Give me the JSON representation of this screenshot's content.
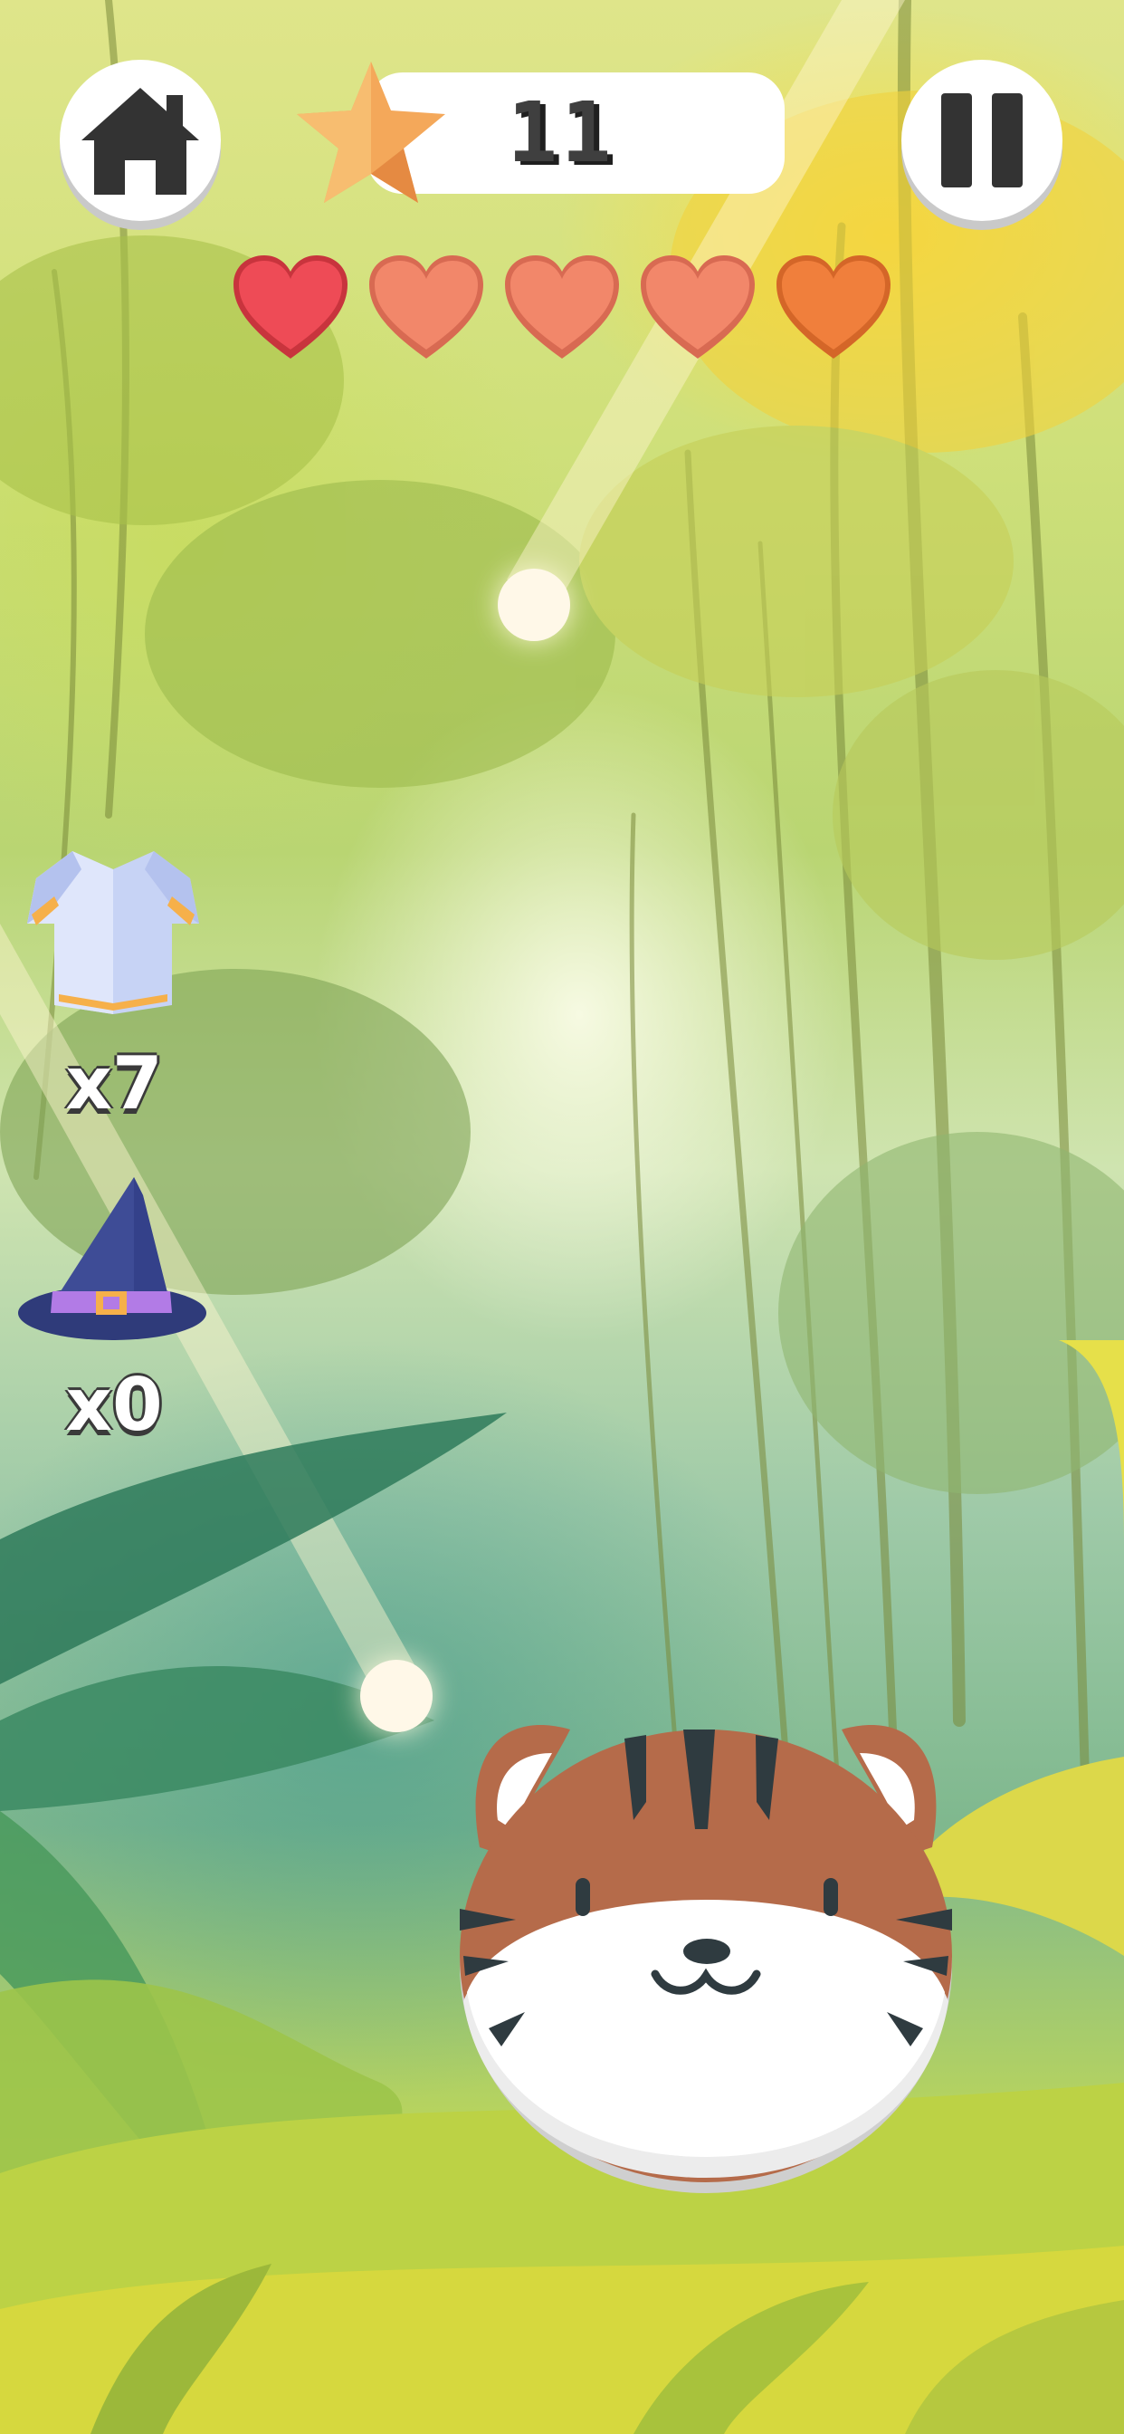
{
  "hud": {
    "score": "11",
    "icons": {
      "home": "home-icon",
      "star": "star-icon",
      "pause": "pause-icon",
      "heart": "heart-icon"
    },
    "hearts": [
      {
        "state": "full",
        "color": "#ee4b56"
      },
      {
        "state": "empty",
        "color": "#f2876a"
      },
      {
        "state": "empty",
        "color": "#f2876a"
      },
      {
        "state": "empty",
        "color": "#f2876a"
      },
      {
        "state": "empty",
        "color": "#f07f3c"
      }
    ]
  },
  "inventory": {
    "armor": {
      "icon": "armor-icon",
      "count": "x7"
    },
    "wizard_hat": {
      "icon": "wizard-hat-icon",
      "count": "x0"
    }
  },
  "player": {
    "character": "tiger",
    "icon": "tiger-face-icon"
  },
  "colors": {
    "tiger_fur": "#b56b4a",
    "tiger_stripes": "#2f3b40",
    "star": "#f4a85a",
    "ball": "#fff8e8"
  }
}
